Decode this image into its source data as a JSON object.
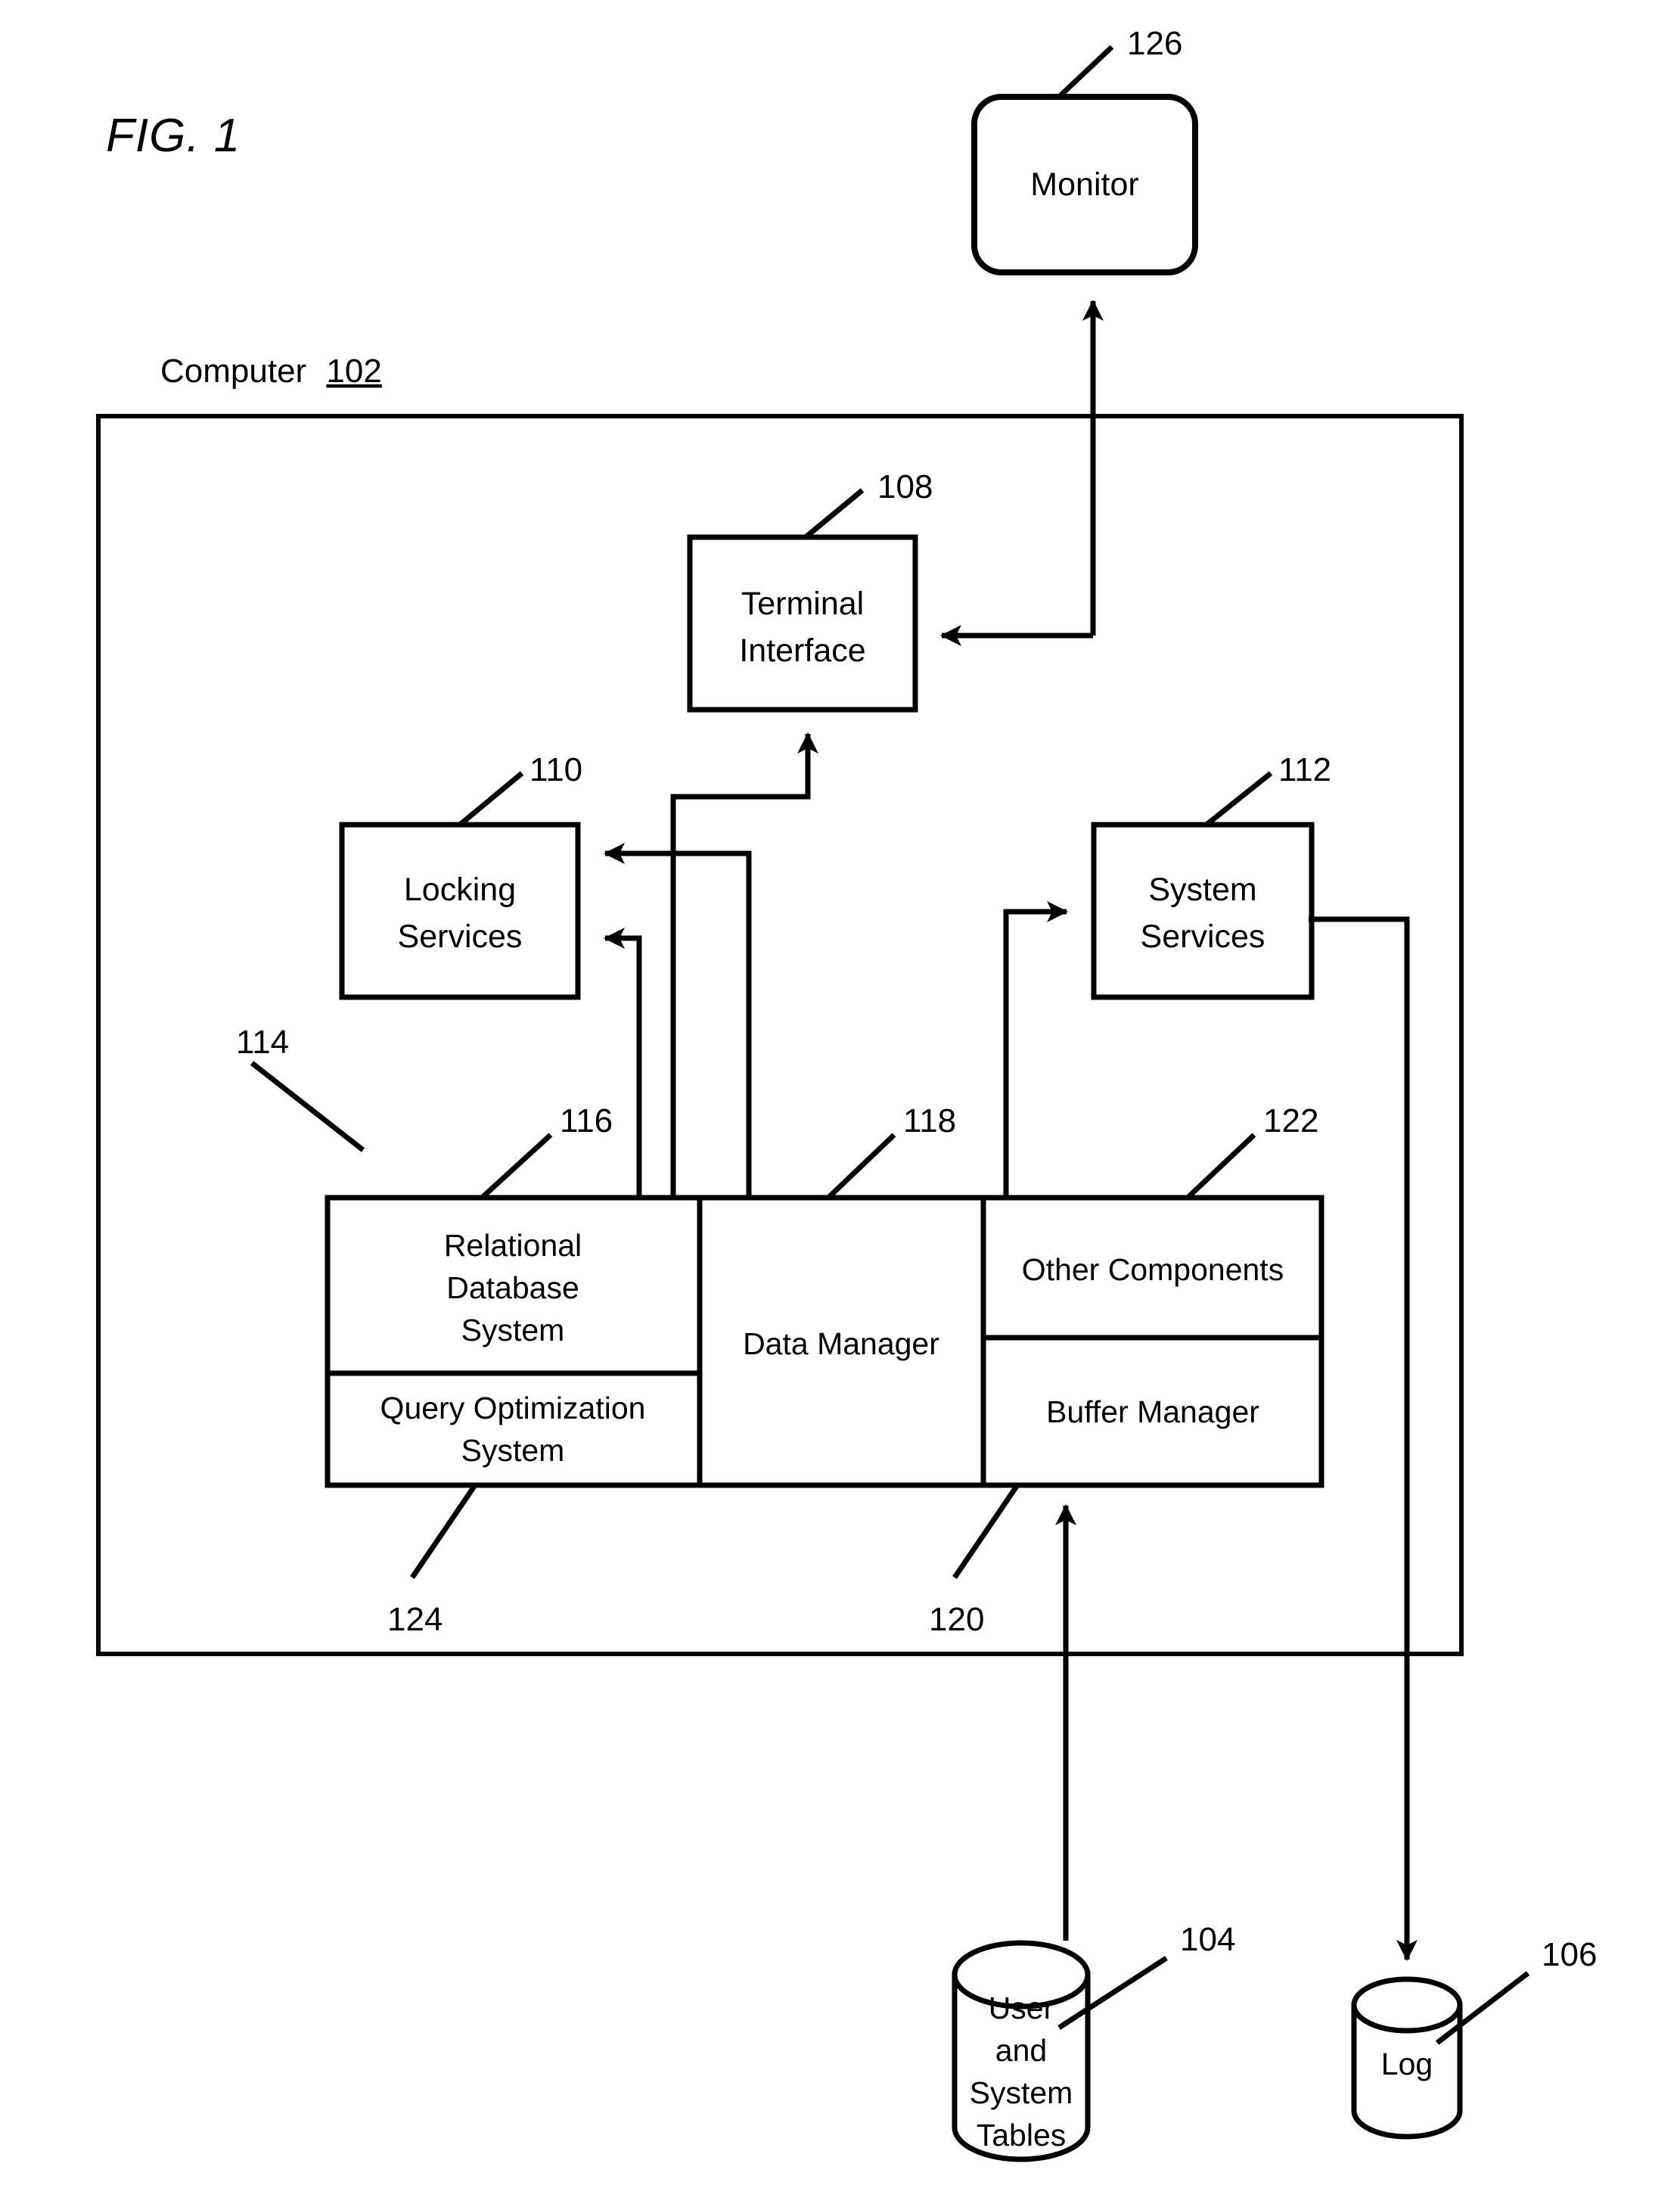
{
  "figure": {
    "title": "FIG. 1",
    "domain_note": "patent block diagram"
  },
  "container": {
    "label_text": "Computer",
    "label_ref": "102"
  },
  "nodes": {
    "monitor": {
      "label": "Monitor",
      "ref": "126"
    },
    "terminal_interface": {
      "label_line1": "Terminal",
      "label_line2": "Interface",
      "ref": "108"
    },
    "locking_services": {
      "label_line1": "Locking",
      "label_line2": "Services",
      "ref": "110"
    },
    "system_services": {
      "label_line1": "System",
      "label_line2": "Services",
      "ref": "112"
    },
    "component_block": {
      "ref": "114"
    },
    "relational_database_system": {
      "label_line1": "Relational",
      "label_line2": "Database",
      "label_line3": "System",
      "ref": "116"
    },
    "query_optimization_system": {
      "label_line1": "Query Optimization",
      "label_line2": "System",
      "ref": "124"
    },
    "data_manager": {
      "label": "Data Manager",
      "ref": "118"
    },
    "other_components": {
      "label": "Other Components",
      "ref": "122"
    },
    "buffer_manager": {
      "label": "Buffer Manager",
      "ref": "120"
    },
    "user_and_system_tables": {
      "label_line1": "User",
      "label_line2": "and",
      "label_line3": "System",
      "label_line4": "Tables",
      "ref": "104"
    },
    "log": {
      "label": "Log",
      "ref": "106"
    }
  },
  "colors": {
    "stroke": "#000000",
    "background": "#ffffff"
  }
}
